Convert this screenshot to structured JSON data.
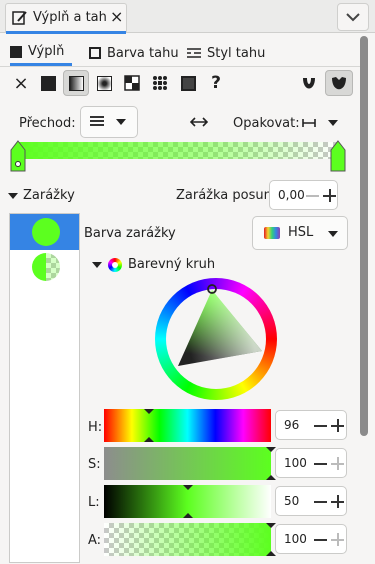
{
  "tab": {
    "title": "Výplň a tah",
    "close": "×"
  },
  "subtabs": [
    {
      "label": "Výplň"
    },
    {
      "label": "Barva tahu"
    },
    {
      "label": "Styl tahu"
    }
  ],
  "paint_types": {
    "none": "×",
    "unset": "?"
  },
  "gradient": {
    "label": "Přechod:",
    "repeat_label": "Opakovat:"
  },
  "stops": {
    "header": "Zarážky",
    "offset_label": "Zarážka posunu:",
    "offset_value": "0,00"
  },
  "stop_color": {
    "label": "Barva zarážky",
    "mode": "HSL"
  },
  "wheel": {
    "label": "Barevný kruh"
  },
  "channels": [
    {
      "label": "H:",
      "value": "96",
      "marker": 0.27
    },
    {
      "label": "S:",
      "value": "100",
      "marker": 1.0
    },
    {
      "label": "L:",
      "value": "50",
      "marker": 0.5
    },
    {
      "label": "A:",
      "value": "100",
      "marker": 1.0
    }
  ],
  "colors": {
    "accent": "#3584e4",
    "selected_color": "#5cff1f",
    "selection_bg": "#3584e4"
  },
  "icons": [
    "edit-icon",
    "close-icon",
    "chevron-down-icon",
    "flat-color-icon",
    "linear-gradient-icon",
    "radial-gradient-icon",
    "mesh-icon",
    "pattern-icon",
    "swatch-icon",
    "unset-icon",
    "fill-rule-evenodd-icon",
    "fill-rule-nonzero-icon",
    "gradient-library-icon",
    "reverse-icon",
    "repeat-icon",
    "add-stop-icon",
    "palette-icon",
    "color-wheel-icon"
  ]
}
